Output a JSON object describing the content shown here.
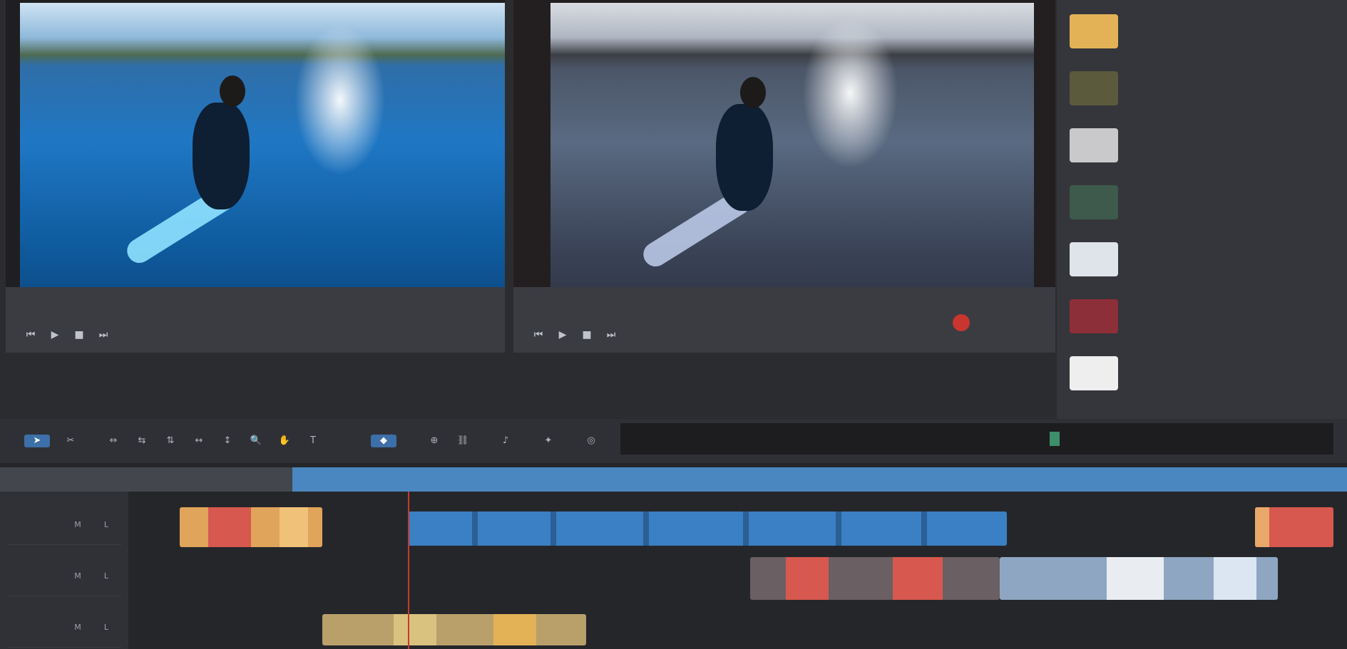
{
  "source_monitor": {
    "label": "",
    "controls": [
      "play",
      "stop",
      "prev-frame",
      "next-frame"
    ]
  },
  "program_monitor": {
    "label": "",
    "controls": [
      "play",
      "stop",
      "prev-frame",
      "next-frame"
    ]
  },
  "media_panel": {
    "items": [
      {
        "label": "",
        "sub": ""
      },
      {
        "label": "",
        "sub": ""
      },
      {
        "label": "",
        "sub": ""
      },
      {
        "label": "",
        "sub": ""
      },
      {
        "label": "",
        "sub": ""
      },
      {
        "label": "",
        "sub": ""
      },
      {
        "label": "",
        "sub": ""
      }
    ]
  },
  "toolbar": {
    "tools": [
      "select",
      "cut",
      "trim",
      "ripple",
      "roll",
      "slip",
      "slide",
      "zoom",
      "hand",
      "text",
      "marker",
      "snap",
      "link",
      "audio",
      "effects",
      "mask"
    ]
  },
  "timeline": {
    "ruler_labels": [],
    "tracks": [
      {
        "name": "",
        "mute": "M",
        "lock": "L"
      },
      {
        "name": "",
        "mute": "M",
        "lock": "L"
      },
      {
        "name": "",
        "mute": "M",
        "lock": "L"
      }
    ],
    "clips": [
      {
        "name": "",
        "track": 0
      },
      {
        "name": "",
        "track": 0
      },
      {
        "name": "",
        "track": 0
      },
      {
        "name": "",
        "track": 1
      },
      {
        "name": "",
        "track": 1
      },
      {
        "name": "",
        "track": 2
      }
    ]
  },
  "colors": {
    "accent": "#4a87c0",
    "record": "#c8362f",
    "playhead": "#c43a30",
    "clip_orange": "#e0a45a",
    "clip_blue": "#3b7fc4",
    "clip_red": "#d6584e"
  },
  "icons": {
    "play": "▶",
    "stop": "■",
    "prev": "⏮",
    "next": "⏭",
    "select": "➤",
    "cut": "✂",
    "trim": "⇔",
    "ripple": "⇆",
    "roll": "⇅",
    "slip": "↔",
    "slide": "↕",
    "zoom": "🔍",
    "hand": "✋",
    "text": "T",
    "marker": "◆",
    "snap": "⊕",
    "link": "⛓",
    "audio": "♪",
    "effects": "✦",
    "mask": "◎"
  }
}
